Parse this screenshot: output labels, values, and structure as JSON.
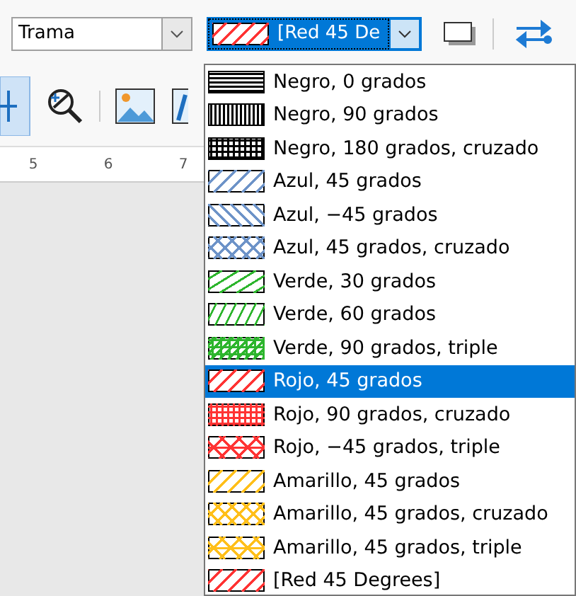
{
  "toolbar": {
    "fill_type": {
      "value": "Trama"
    },
    "hatch_combo": {
      "value": "[Red 45 De",
      "color": "#ff3333",
      "kind": "diagonal"
    }
  },
  "ruler": {
    "marks": [
      "5",
      "6",
      "7"
    ]
  },
  "hatch_list": {
    "items": [
      {
        "label": "Negro, 0 grados",
        "color": "#000000",
        "kind": "horizontal",
        "selected": false
      },
      {
        "label": "Negro, 90 grados",
        "color": "#000000",
        "kind": "vertical",
        "selected": false
      },
      {
        "label": "Negro, 180 grados, cruzado",
        "color": "#000000",
        "kind": "grid",
        "selected": false
      },
      {
        "label": "Azul, 45 grados",
        "color": "#6d93c8",
        "kind": "diagonal",
        "selected": false
      },
      {
        "label": "Azul, −45 grados",
        "color": "#6d93c8",
        "kind": "antidiagonal",
        "selected": false
      },
      {
        "label": "Azul, 45 grados, cruzado",
        "color": "#6d93c8",
        "kind": "diamond",
        "selected": false
      },
      {
        "label": "Verde, 30 grados",
        "color": "#2db52d",
        "kind": "shallow",
        "selected": false
      },
      {
        "label": "Verde, 60 grados",
        "color": "#2db52d",
        "kind": "steep",
        "selected": false
      },
      {
        "label": "Verde, 90 grados, triple",
        "color": "#2db52d",
        "kind": "gridtriple",
        "selected": false
      },
      {
        "label": "Rojo, 45 grados",
        "color": "#ff3333",
        "kind": "diagonal",
        "selected": true
      },
      {
        "label": "Rojo, 90 grados, cruzado",
        "color": "#ff3333",
        "kind": "grid",
        "selected": false
      },
      {
        "label": "Rojo, −45 grados, triple",
        "color": "#ff3333",
        "kind": "diamondtriple",
        "selected": false
      },
      {
        "label": "Amarillo, 45 grados",
        "color": "#ffbf1a",
        "kind": "diagonal",
        "selected": false
      },
      {
        "label": "Amarillo, 45 grados, cruzado",
        "color": "#ffbf1a",
        "kind": "diamond",
        "selected": false
      },
      {
        "label": "Amarillo, 45 grados, triple",
        "color": "#ffbf1a",
        "kind": "diamondtriple",
        "selected": false
      },
      {
        "label": "[Red 45 Degrees]",
        "color": "#ff3333",
        "kind": "diagonal",
        "selected": false
      }
    ]
  }
}
